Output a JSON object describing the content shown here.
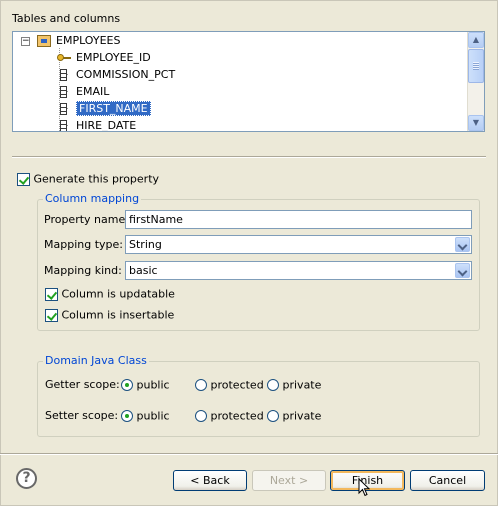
{
  "tables_section": {
    "label": "Tables and columns",
    "root": "EMPLOYEES",
    "columns": [
      "EMPLOYEE_ID",
      "COMMISSION_PCT",
      "EMAIL",
      "FIRST_NAME",
      "HIRE_DATE"
    ],
    "selected": "FIRST_NAME"
  },
  "generate_property": {
    "label": "Generate this property",
    "checked": true
  },
  "column_mapping": {
    "legend": "Column mapping",
    "property_name_label": "Property name:",
    "property_name_value": "firstName",
    "mapping_type_label": "Mapping type:",
    "mapping_type_value": "String",
    "mapping_kind_label": "Mapping kind:",
    "mapping_kind_value": "basic",
    "updatable_label": "Column is updatable",
    "insertable_label": "Column is insertable"
  },
  "domain_class": {
    "legend": "Domain Java Class",
    "getter_label": "Getter scope:",
    "setter_label": "Setter scope:",
    "options": [
      "public",
      "protected",
      "private"
    ],
    "getter_selected": "public",
    "setter_selected": "public"
  },
  "buttons": {
    "help": "?",
    "back": "< Back",
    "next": "Next >",
    "finish": "Finish",
    "cancel": "Cancel"
  },
  "colors": {
    "selection": "#316ac5",
    "legend": "#0046d5",
    "background": "#ece9d8"
  }
}
